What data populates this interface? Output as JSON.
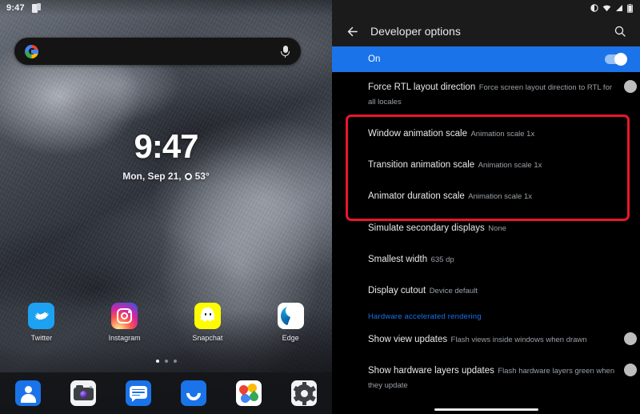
{
  "home": {
    "statusbar": {
      "time": "9:47",
      "icon": "sim-card-icon"
    },
    "search": {
      "placeholder": "",
      "value": "",
      "left_icon": "google-logo-icon",
      "right_icon": "microphone-icon"
    },
    "clock": {
      "time": "9:47",
      "date": "Mon, Sep 21,",
      "weather_icon": "sun-icon",
      "temperature": "53°"
    },
    "apps": [
      {
        "label": "Twitter",
        "icon": "twitter-icon"
      },
      {
        "label": "Instagram",
        "icon": "instagram-icon"
      },
      {
        "label": "Snapchat",
        "icon": "snapchat-icon"
      },
      {
        "label": "Edge",
        "icon": "edge-icon"
      }
    ],
    "page_dots": {
      "count": 3,
      "active": 0
    },
    "dock": [
      {
        "label": "Contacts",
        "icon": "contacts-icon"
      },
      {
        "label": "Camera",
        "icon": "camera-icon"
      },
      {
        "label": "Messages",
        "icon": "messages-icon"
      },
      {
        "label": "Phone",
        "icon": "phone-icon"
      },
      {
        "label": "Photos",
        "icon": "google-photos-icon"
      },
      {
        "label": "Settings",
        "icon": "settings-gear-icon"
      }
    ]
  },
  "settings": {
    "statusbar": {
      "icons": [
        "do-not-disturb-icon",
        "wifi-icon",
        "signal-icon",
        "battery-icon"
      ]
    },
    "appbar": {
      "back_icon": "back-arrow-icon",
      "title": "Developer options",
      "search_icon": "search-icon"
    },
    "master_toggle": {
      "label": "On",
      "state": "on"
    },
    "items": [
      {
        "title": "Force RTL layout direction",
        "sub": "Force screen layout direction to RTL for all locales",
        "control": "toggle",
        "state": "off"
      },
      {
        "title": "Window animation scale",
        "sub": "Animation scale 1x",
        "control": "none",
        "highlighted": true
      },
      {
        "title": "Transition animation scale",
        "sub": "Animation scale 1x",
        "control": "none",
        "highlighted": true
      },
      {
        "title": "Animator duration scale",
        "sub": "Animation scale 1x",
        "control": "none",
        "highlighted": true
      },
      {
        "title": "Simulate secondary displays",
        "sub": "None",
        "control": "none"
      },
      {
        "title": "Smallest width",
        "sub": "635 dp",
        "control": "none"
      },
      {
        "title": "Display cutout",
        "sub": "Device default",
        "control": "none"
      }
    ],
    "section_header": "Hardware accelerated rendering",
    "items2": [
      {
        "title": "Show view updates",
        "sub": "Flash views inside windows when drawn",
        "control": "toggle",
        "state": "off"
      },
      {
        "title": "Show hardware layers updates",
        "sub": "Flash hardware layers green when they update",
        "control": "toggle",
        "state": "off"
      }
    ],
    "highlight_color": "#e8172b",
    "accent_color": "#1a73e8"
  }
}
